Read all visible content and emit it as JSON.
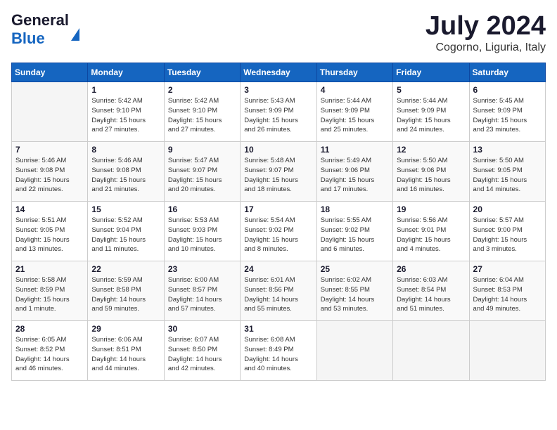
{
  "header": {
    "logo_general": "General",
    "logo_blue": "Blue",
    "month": "July 2024",
    "location": "Cogorno, Liguria, Italy"
  },
  "columns": [
    "Sunday",
    "Monday",
    "Tuesday",
    "Wednesday",
    "Thursday",
    "Friday",
    "Saturday"
  ],
  "weeks": [
    [
      {
        "day": "",
        "info": ""
      },
      {
        "day": "1",
        "info": "Sunrise: 5:42 AM\nSunset: 9:10 PM\nDaylight: 15 hours\nand 27 minutes."
      },
      {
        "day": "2",
        "info": "Sunrise: 5:42 AM\nSunset: 9:10 PM\nDaylight: 15 hours\nand 27 minutes."
      },
      {
        "day": "3",
        "info": "Sunrise: 5:43 AM\nSunset: 9:09 PM\nDaylight: 15 hours\nand 26 minutes."
      },
      {
        "day": "4",
        "info": "Sunrise: 5:44 AM\nSunset: 9:09 PM\nDaylight: 15 hours\nand 25 minutes."
      },
      {
        "day": "5",
        "info": "Sunrise: 5:44 AM\nSunset: 9:09 PM\nDaylight: 15 hours\nand 24 minutes."
      },
      {
        "day": "6",
        "info": "Sunrise: 5:45 AM\nSunset: 9:09 PM\nDaylight: 15 hours\nand 23 minutes."
      }
    ],
    [
      {
        "day": "7",
        "info": "Sunrise: 5:46 AM\nSunset: 9:08 PM\nDaylight: 15 hours\nand 22 minutes."
      },
      {
        "day": "8",
        "info": "Sunrise: 5:46 AM\nSunset: 9:08 PM\nDaylight: 15 hours\nand 21 minutes."
      },
      {
        "day": "9",
        "info": "Sunrise: 5:47 AM\nSunset: 9:07 PM\nDaylight: 15 hours\nand 20 minutes."
      },
      {
        "day": "10",
        "info": "Sunrise: 5:48 AM\nSunset: 9:07 PM\nDaylight: 15 hours\nand 18 minutes."
      },
      {
        "day": "11",
        "info": "Sunrise: 5:49 AM\nSunset: 9:06 PM\nDaylight: 15 hours\nand 17 minutes."
      },
      {
        "day": "12",
        "info": "Sunrise: 5:50 AM\nSunset: 9:06 PM\nDaylight: 15 hours\nand 16 minutes."
      },
      {
        "day": "13",
        "info": "Sunrise: 5:50 AM\nSunset: 9:05 PM\nDaylight: 15 hours\nand 14 minutes."
      }
    ],
    [
      {
        "day": "14",
        "info": "Sunrise: 5:51 AM\nSunset: 9:05 PM\nDaylight: 15 hours\nand 13 minutes."
      },
      {
        "day": "15",
        "info": "Sunrise: 5:52 AM\nSunset: 9:04 PM\nDaylight: 15 hours\nand 11 minutes."
      },
      {
        "day": "16",
        "info": "Sunrise: 5:53 AM\nSunset: 9:03 PM\nDaylight: 15 hours\nand 10 minutes."
      },
      {
        "day": "17",
        "info": "Sunrise: 5:54 AM\nSunset: 9:02 PM\nDaylight: 15 hours\nand 8 minutes."
      },
      {
        "day": "18",
        "info": "Sunrise: 5:55 AM\nSunset: 9:02 PM\nDaylight: 15 hours\nand 6 minutes."
      },
      {
        "day": "19",
        "info": "Sunrise: 5:56 AM\nSunset: 9:01 PM\nDaylight: 15 hours\nand 4 minutes."
      },
      {
        "day": "20",
        "info": "Sunrise: 5:57 AM\nSunset: 9:00 PM\nDaylight: 15 hours\nand 3 minutes."
      }
    ],
    [
      {
        "day": "21",
        "info": "Sunrise: 5:58 AM\nSunset: 8:59 PM\nDaylight: 15 hours\nand 1 minute."
      },
      {
        "day": "22",
        "info": "Sunrise: 5:59 AM\nSunset: 8:58 PM\nDaylight: 14 hours\nand 59 minutes."
      },
      {
        "day": "23",
        "info": "Sunrise: 6:00 AM\nSunset: 8:57 PM\nDaylight: 14 hours\nand 57 minutes."
      },
      {
        "day": "24",
        "info": "Sunrise: 6:01 AM\nSunset: 8:56 PM\nDaylight: 14 hours\nand 55 minutes."
      },
      {
        "day": "25",
        "info": "Sunrise: 6:02 AM\nSunset: 8:55 PM\nDaylight: 14 hours\nand 53 minutes."
      },
      {
        "day": "26",
        "info": "Sunrise: 6:03 AM\nSunset: 8:54 PM\nDaylight: 14 hours\nand 51 minutes."
      },
      {
        "day": "27",
        "info": "Sunrise: 6:04 AM\nSunset: 8:53 PM\nDaylight: 14 hours\nand 49 minutes."
      }
    ],
    [
      {
        "day": "28",
        "info": "Sunrise: 6:05 AM\nSunset: 8:52 PM\nDaylight: 14 hours\nand 46 minutes."
      },
      {
        "day": "29",
        "info": "Sunrise: 6:06 AM\nSunset: 8:51 PM\nDaylight: 14 hours\nand 44 minutes."
      },
      {
        "day": "30",
        "info": "Sunrise: 6:07 AM\nSunset: 8:50 PM\nDaylight: 14 hours\nand 42 minutes."
      },
      {
        "day": "31",
        "info": "Sunrise: 6:08 AM\nSunset: 8:49 PM\nDaylight: 14 hours\nand 40 minutes."
      },
      {
        "day": "",
        "info": ""
      },
      {
        "day": "",
        "info": ""
      },
      {
        "day": "",
        "info": ""
      }
    ]
  ]
}
